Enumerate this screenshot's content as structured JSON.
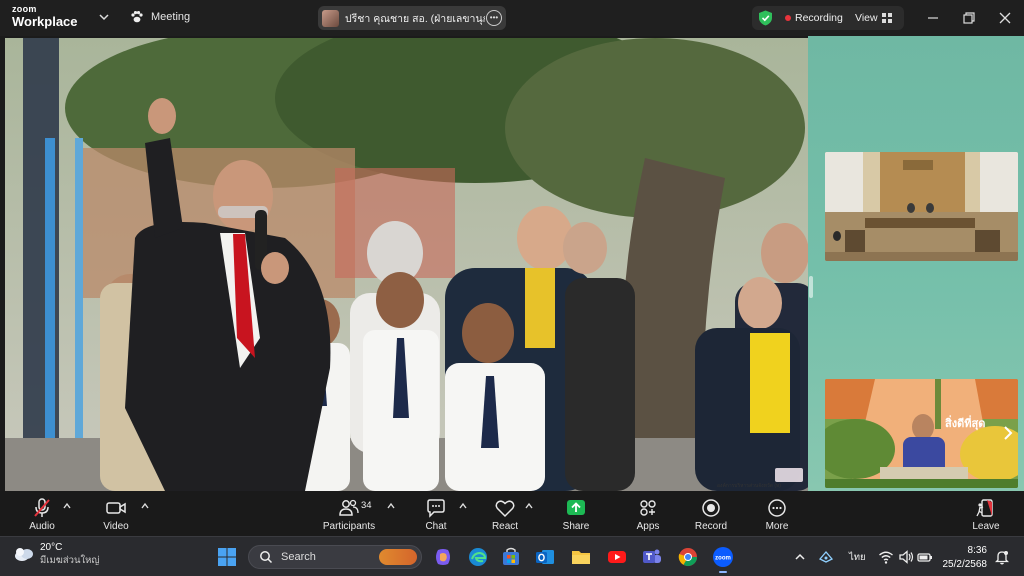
{
  "titlebar": {
    "brand_top": "zoom",
    "brand_bottom": "Workplace",
    "meeting_label": "Meeting",
    "host_label": "ปรีชา คุณชาย สอ. (ฝ่ายเลขานุการ)'s",
    "recording_label": "Recording",
    "view_label": "View"
  },
  "video": {
    "watermark": "องค์การบริหารส่วนจังหวัด (ท)",
    "thumb2_banner": "สิ่งดีที่สุด"
  },
  "toolbar": {
    "audio": "Audio",
    "video": "Video",
    "participants": "Participants",
    "participant_count": "34",
    "chat": "Chat",
    "react": "React",
    "share": "Share",
    "apps": "Apps",
    "record": "Record",
    "more": "More",
    "leave": "Leave"
  },
  "taskbar": {
    "temperature": "20°C",
    "weather_desc": "มีเมฆส่วนใหญ่",
    "search_placeholder": "Search",
    "language": "ไทย",
    "time": "8:36",
    "date": "25/2/2568"
  },
  "colors": {
    "share_green": "#1db954",
    "recording_red": "#e8343c",
    "shield_green": "#2fbf5b",
    "sidebar_teal": "#74bfaa"
  }
}
